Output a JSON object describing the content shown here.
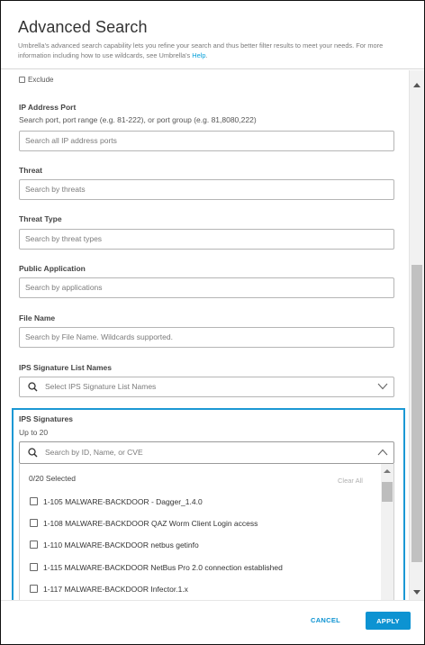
{
  "dialog": {
    "title": "Advanced Search",
    "description": "Umbrella's advanced search capability lets you refine your search and thus better filter results to meet your needs. For more information including how to use wildcards, see Umbrella's",
    "help_link": "Help",
    "description_end": "."
  },
  "exclude_label": "Exclude",
  "fields": {
    "ip_port": {
      "label": "IP Address Port",
      "hint": "Search port, port range (e.g. 81-222), or port group (e.g. 81,8080,222)",
      "placeholder": "Search all IP address ports"
    },
    "threat": {
      "label": "Threat",
      "placeholder": "Search by threats"
    },
    "threat_type": {
      "label": "Threat Type",
      "placeholder": "Search by threat types"
    },
    "public_app": {
      "label": "Public Application",
      "placeholder": "Search by applications"
    },
    "file_name": {
      "label": "File Name",
      "placeholder": "Search by File Name. Wildcards supported."
    },
    "ips_list": {
      "label": "IPS Signature List Names",
      "placeholder": "Select IPS Signature List Names"
    },
    "ips_signatures": {
      "label": "IPS Signatures",
      "hint": "Up to 20",
      "placeholder": "Search by ID, Name, or CVE",
      "selected_count": "0/20 Selected",
      "clear_all": "Clear All",
      "options": [
        "1-105 MALWARE-BACKDOOR - Dagger_1.4.0",
        "1-108 MALWARE-BACKDOOR QAZ Worm Client Login access",
        "1-110 MALWARE-BACKDOOR netbus getinfo",
        "1-115 MALWARE-BACKDOOR NetBus Pro 2.0 connection established",
        "1-117 MALWARE-BACKDOOR Infector.1.x"
      ]
    }
  },
  "footer": {
    "cancel_label": "CANCEL",
    "apply_label": "APPLY"
  },
  "colors": {
    "accent": "#0d93d2",
    "highlight_border": "#1b98d4"
  }
}
